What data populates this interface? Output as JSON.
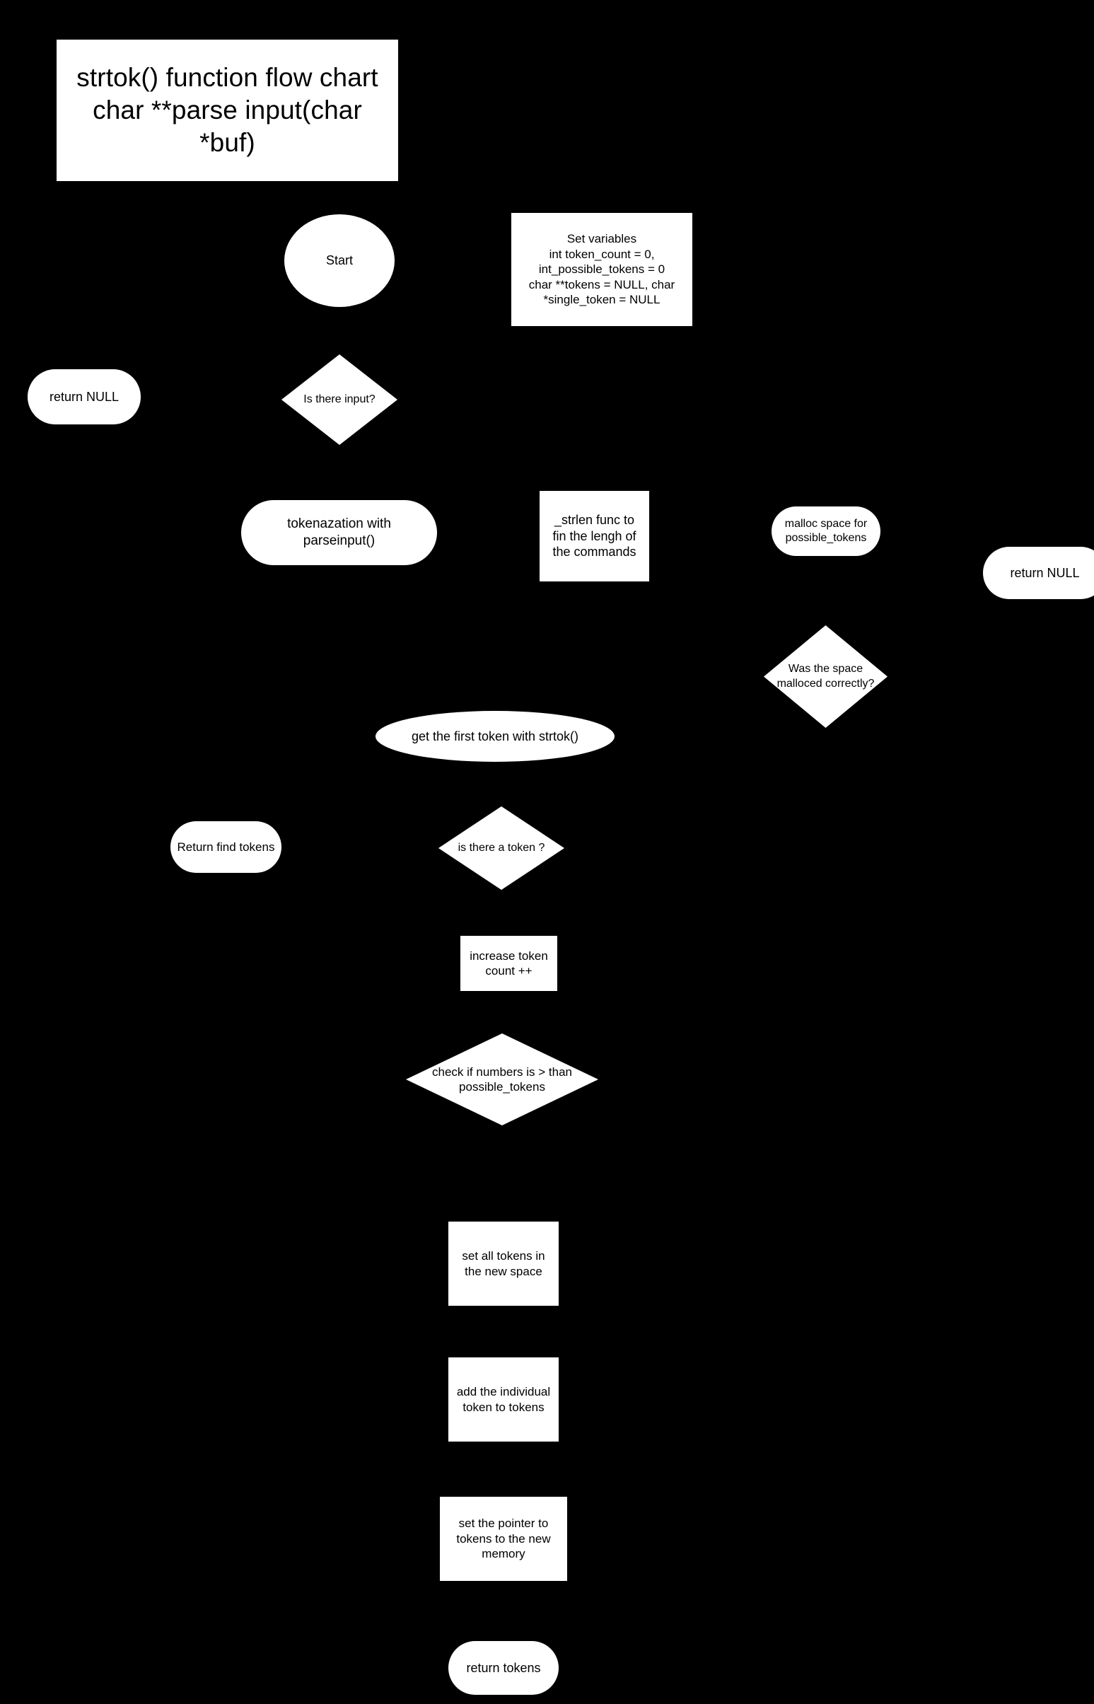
{
  "diagram": {
    "title": "strtok() function flow chart\nchar **parse input(char *buf)",
    "background_color": "#000000",
    "shape_fill_color": "#ffffff",
    "text_color": "#000000"
  },
  "nodes": {
    "title_block": {
      "label": "strtok() function flow chart\nchar **parse input(char *buf)",
      "shape": "rectangle"
    },
    "start": {
      "label": "Start",
      "shape": "ellipse"
    },
    "set_variables": {
      "label": "Set variables\nint token_count = 0,\nint_possible_tokens = 0\nchar **tokens = NULL,     char *single_token = NULL",
      "shape": "rectangle"
    },
    "return_null_left": {
      "label": "return NULL",
      "shape": "stadium"
    },
    "is_there_input": {
      "label": "Is there input?",
      "shape": "diamond"
    },
    "tokenazation": {
      "label": "tokenazation with parseinput()",
      "shape": "stadium"
    },
    "strlen_func": {
      "label": "_strlen func to fin the lengh of the commands",
      "shape": "rectangle"
    },
    "malloc_space": {
      "label": "malloc space for possible_tokens",
      "shape": "stadium"
    },
    "return_null_right": {
      "label": "return NULL",
      "shape": "stadium"
    },
    "was_malloced": {
      "label": "Was the space malloced correctly?",
      "shape": "diamond"
    },
    "get_first_token": {
      "label": "get the first token with strtok()",
      "shape": "ellipse"
    },
    "return_find_tokens": {
      "label": "Return find tokens",
      "shape": "stadium"
    },
    "is_there_a_token": {
      "label": "is there a token ?",
      "shape": "diamond"
    },
    "increase_token_count": {
      "label": "increase token count ++",
      "shape": "rectangle"
    },
    "check_numbers": {
      "label": "check if numbers is > than possible_tokens",
      "shape": "diamond"
    },
    "set_all_tokens": {
      "label": "set all tokens in the new space",
      "shape": "rectangle"
    },
    "add_individual_token": {
      "label": "add the individual token to tokens",
      "shape": "rectangle"
    },
    "set_pointer": {
      "label": "set the pointer to tokens to the new memory",
      "shape": "rectangle"
    },
    "return_tokens": {
      "label": "return tokens",
      "shape": "stadium"
    }
  }
}
